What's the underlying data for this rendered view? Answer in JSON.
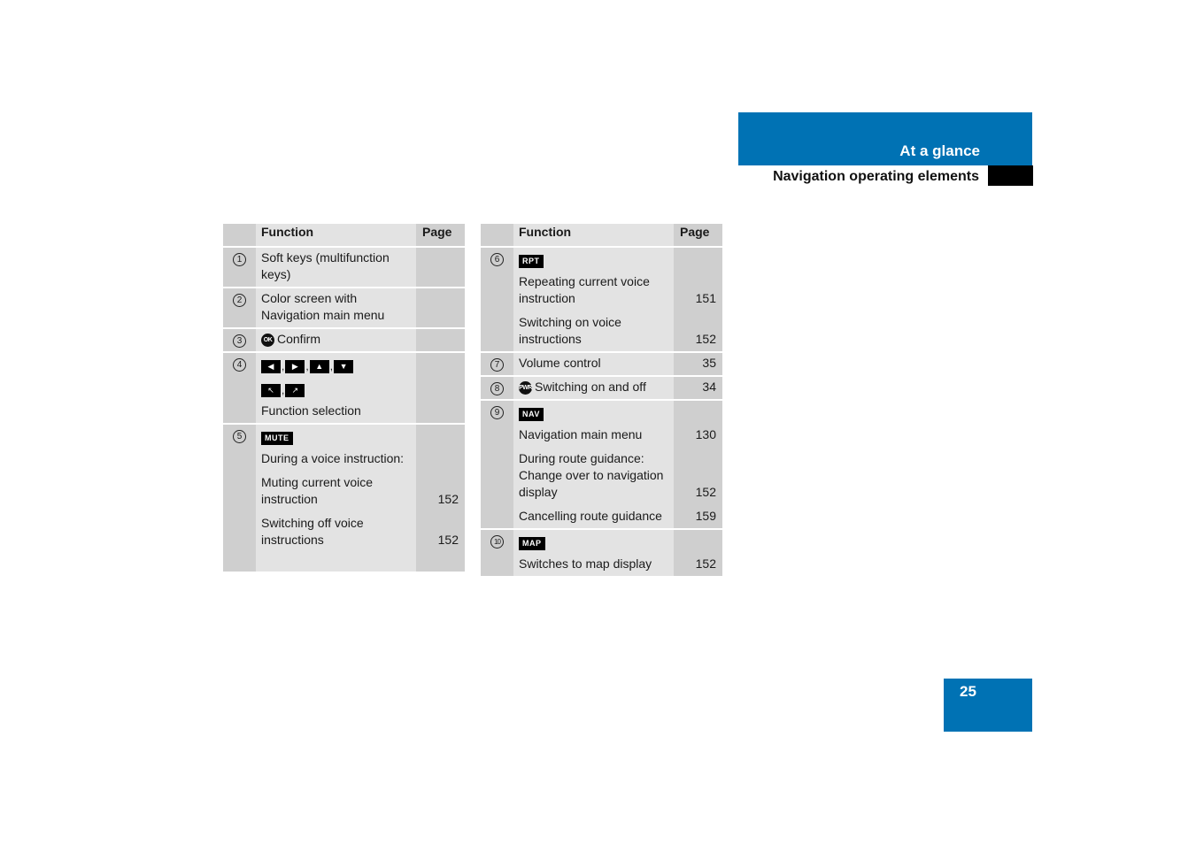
{
  "header": {
    "section": "At a glance",
    "subsection": "Navigation operating elements",
    "accent_color": "#0072b4"
  },
  "page_number": "25",
  "tables": [
    {
      "columns": [
        "Function",
        "Page"
      ],
      "rows": [
        {
          "num": "1",
          "lines": [
            {
              "text": "Soft keys (multifunction keys)",
              "page": ""
            }
          ]
        },
        {
          "num": "2",
          "lines": [
            {
              "text": "Color screen with Navigation main menu",
              "page": ""
            }
          ]
        },
        {
          "num": "3",
          "icon": "OK",
          "lines": [
            {
              "text": "Confirm",
              "page": ""
            }
          ]
        },
        {
          "num": "4",
          "keys": [
            "◀",
            "▶",
            "▲",
            "▼"
          ],
          "keys2": [
            "↖",
            "↗"
          ],
          "lines": [
            {
              "text": "Function selection",
              "page": ""
            }
          ]
        },
        {
          "num": "5",
          "key": "MUTE",
          "lines": [
            {
              "text": "During a voice instruction:",
              "page": ""
            },
            {
              "text": "Muting current voice instruction",
              "page": "152"
            },
            {
              "text": "Switching off voice instructions",
              "page": "152"
            }
          ]
        }
      ]
    },
    {
      "columns": [
        "Function",
        "Page"
      ],
      "rows": [
        {
          "num": "6",
          "key": "RPT",
          "lines": [
            {
              "text": "Repeating current voice instruction",
              "page": "151"
            },
            {
              "text": "Switching on voice instructions",
              "page": "152"
            }
          ]
        },
        {
          "num": "7",
          "lines": [
            {
              "text": "Volume control",
              "page": "35"
            }
          ]
        },
        {
          "num": "8",
          "icon": "PWR",
          "lines": [
            {
              "text": "Switching on and off",
              "page": "34"
            }
          ]
        },
        {
          "num": "9",
          "key": "NAV",
          "lines": [
            {
              "text": "Navigation main menu",
              "page": "130"
            },
            {
              "text": "During route guidance: Change over to navigation display",
              "page": "152"
            },
            {
              "text": "Cancelling route guidance",
              "page": "159"
            }
          ]
        },
        {
          "num": "10",
          "key": "MAP",
          "lines": [
            {
              "text": "Switches to map display",
              "page": "152"
            }
          ]
        }
      ]
    }
  ]
}
